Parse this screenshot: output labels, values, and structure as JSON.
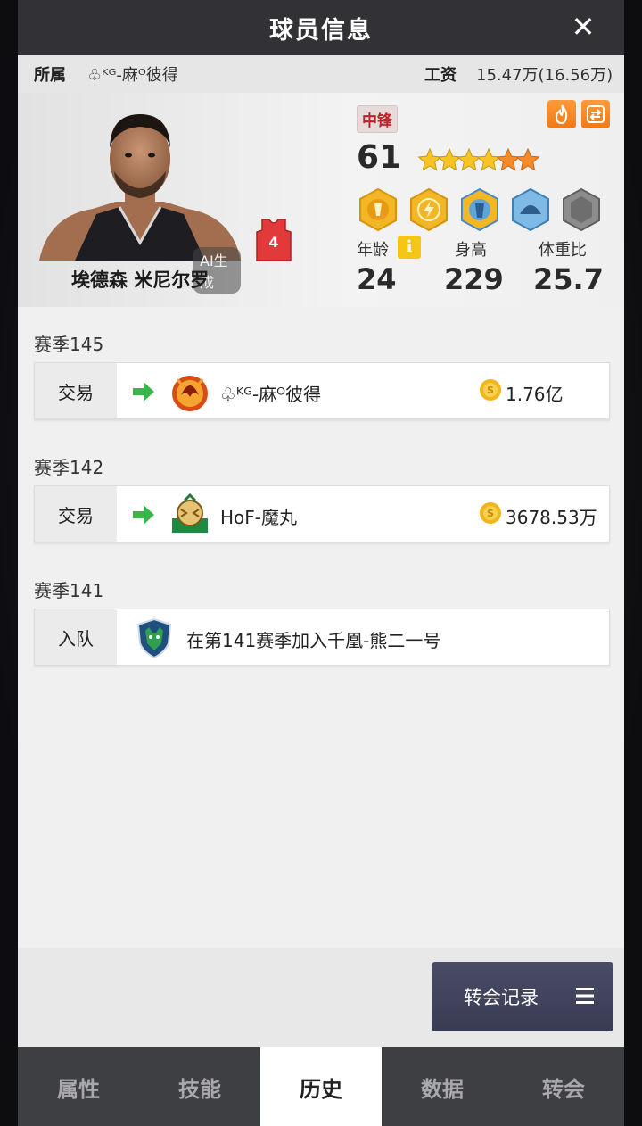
{
  "header": {
    "title": "球员信息",
    "close_label": "✕"
  },
  "affiliation": {
    "label": "所属",
    "team": "♧ᴷᴳ-麻ᴼ彼得",
    "salary_label": "工资",
    "salary": "15.47万(16.56万)"
  },
  "player": {
    "name": "埃德森 米尼尔罗",
    "ai_tag": "AI生成",
    "jersey_number": "4",
    "position": "中锋",
    "rating": "61",
    "stars": 6,
    "stats": [
      {
        "label": "年龄",
        "value": "24"
      },
      {
        "label": "身高",
        "value": "229"
      },
      {
        "label": "体重比",
        "value": "25.7"
      }
    ],
    "info_icon": "i"
  },
  "history": [
    {
      "season": "赛季145",
      "kind": "交易",
      "team": "♧ᴷᴳ-麻ᴼ彼得",
      "price": "1.76亿"
    },
    {
      "season": "赛季142",
      "kind": "交易",
      "team": "HoF-魔丸",
      "price": "3678.53万"
    },
    {
      "season": "赛季141",
      "kind": "入队",
      "team": "在第141赛季加入千凰-熊二一号"
    }
  ],
  "transfer_button": {
    "label": "转会记录"
  },
  "tabs": [
    {
      "label": "属性"
    },
    {
      "label": "技能"
    },
    {
      "label": "历史"
    },
    {
      "label": "数据"
    },
    {
      "label": "转会"
    }
  ],
  "colors": {
    "position_badge": "#c0222a",
    "star_gold": "#f7c325",
    "star_orange": "#f58a2a",
    "arrow_green": "#39b54a",
    "tab_active_bg": "#ffffff",
    "tab_bar_bg": "#3e3f43"
  }
}
